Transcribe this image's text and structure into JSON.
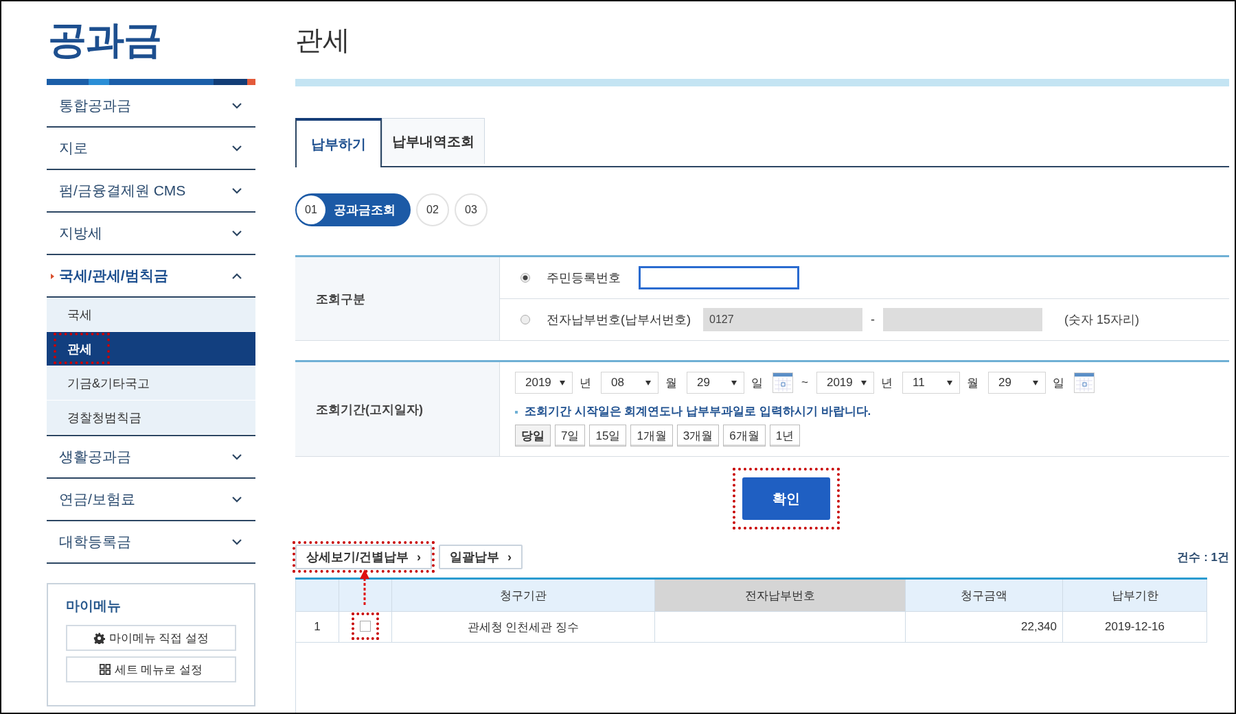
{
  "sidebar": {
    "title": "공과금",
    "menu": [
      {
        "label": "통합공과금",
        "expanded": false
      },
      {
        "label": "지로",
        "expanded": false
      },
      {
        "label": "펌/금융결제원 CMS",
        "expanded": false
      },
      {
        "label": "지방세",
        "expanded": false
      },
      {
        "label": "국세/관세/범칙금",
        "expanded": true,
        "children": [
          {
            "label": "국세",
            "selected": false,
            "highlighted": false
          },
          {
            "label": "관세",
            "selected": true,
            "highlighted": true
          },
          {
            "label": "기금&기타국고",
            "selected": false,
            "highlighted": false
          },
          {
            "label": "경찰청범칙금",
            "selected": false,
            "highlighted": false
          }
        ]
      },
      {
        "label": "생활공과금",
        "expanded": false
      },
      {
        "label": "연금/보험료",
        "expanded": false
      },
      {
        "label": "대학등록금",
        "expanded": false
      }
    ],
    "my_menu": {
      "title": "마이메뉴",
      "buttons": [
        {
          "label": "마이메뉴 직접 설정",
          "kind": "gear"
        },
        {
          "label": "세트 메뉴로 설정",
          "kind": "grid"
        }
      ]
    }
  },
  "page_title": "관세",
  "tabs": [
    {
      "label": "납부하기",
      "selected": true
    },
    {
      "label": "납부내역조회",
      "selected": false
    }
  ],
  "steps": [
    {
      "number": "01",
      "label": "공과금조회",
      "selected": true
    },
    {
      "number": "02",
      "selected": false
    },
    {
      "number": "03",
      "selected": false
    }
  ],
  "lookup_type": {
    "label": "조회구분",
    "options": [
      {
        "label": "주민등록번호",
        "selected": true,
        "inputs": [
          {
            "disabled": false,
            "focused": true
          }
        ]
      },
      {
        "label": "전자납부번호(납부서번호)",
        "selected": false,
        "inputs": [
          {
            "value": "0127",
            "disabled": true,
            "focused": false
          },
          {
            "disabled": true,
            "focused": false
          }
        ],
        "separator": "-",
        "note": "(숫자 15자리)"
      }
    ]
  },
  "period": {
    "label": "조회기간(고지일자)",
    "from": [
      {
        "value": "2019",
        "unit": "년"
      },
      {
        "value": "08",
        "unit": "월"
      },
      {
        "value": "29",
        "unit": "일"
      }
    ],
    "separator": "~",
    "to": [
      {
        "value": "2019",
        "unit": "년"
      },
      {
        "value": "11",
        "unit": "월"
      },
      {
        "value": "29",
        "unit": "일"
      }
    ],
    "notice": "조회기간 시작일은 회계연도나 납부부과일로 입력하시기 바랍니다.",
    "quick_ranges": [
      {
        "label": "당일",
        "selected": true
      },
      {
        "label": "7일",
        "selected": false
      },
      {
        "label": "15일",
        "selected": false
      },
      {
        "label": "1개월",
        "selected": false
      },
      {
        "label": "3개월",
        "selected": false
      },
      {
        "label": "6개월",
        "selected": false
      },
      {
        "label": "1년",
        "selected": false
      }
    ]
  },
  "confirm_button": {
    "label": "확인",
    "highlighted": true
  },
  "actions": [
    {
      "label": "상세보기/건별납부",
      "icon": "›",
      "highlighted": true
    },
    {
      "label": "일괄납부",
      "icon": "›",
      "highlighted": false
    }
  ],
  "count": "건수 : 1건",
  "table": {
    "columns": [
      {
        "label": "청구기관",
        "shaded": false
      },
      {
        "label": "전자납부번호",
        "shaded": true
      },
      {
        "label": "청구금액",
        "shaded": false
      },
      {
        "label": "납부기한",
        "shaded": false
      }
    ],
    "rows": [
      {
        "number": "1",
        "checked": false,
        "highlighted": true,
        "agency": "관세청 인천세관 징수",
        "amount": "22,340",
        "due_date": "2019-12-16"
      }
    ]
  }
}
